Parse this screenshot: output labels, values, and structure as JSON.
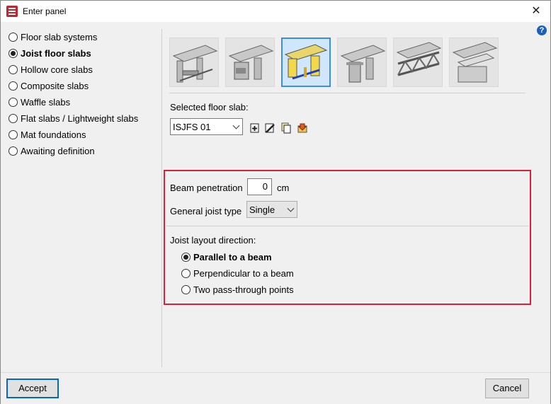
{
  "window": {
    "title": "Enter panel",
    "close_glyph": "✕"
  },
  "help": {
    "glyph": "?"
  },
  "slab_types": [
    {
      "label": "Floor slab systems",
      "checked": false
    },
    {
      "label": "Joist floor slabs",
      "checked": true
    },
    {
      "label": "Hollow core slabs",
      "checked": false
    },
    {
      "label": "Composite slabs",
      "checked": false
    },
    {
      "label": "Waffle slabs",
      "checked": false
    },
    {
      "label": "Flat slabs / Lightweight slabs",
      "checked": false
    },
    {
      "label": "Mat foundations",
      "checked": false
    },
    {
      "label": "Awaiting definition",
      "checked": false
    }
  ],
  "thumbnails": [
    {
      "icon": "joist-type-1-icon",
      "selected": false
    },
    {
      "icon": "joist-type-2-icon",
      "selected": false
    },
    {
      "icon": "joist-type-3-icon",
      "selected": true
    },
    {
      "icon": "joist-type-4-icon",
      "selected": false
    },
    {
      "icon": "truss-joist-icon",
      "selected": false
    },
    {
      "icon": "solid-block-icon",
      "selected": false
    }
  ],
  "selected_floor_slab": {
    "label": "Selected floor slab:",
    "value": "ISJFS 01"
  },
  "tools": [
    "add-icon",
    "edit-icon",
    "copy-icon",
    "import-icon"
  ],
  "beam_penetration": {
    "label": "Beam penetration",
    "value": "0",
    "unit": "cm"
  },
  "general_joist_type": {
    "label": "General joist type",
    "value": "Single"
  },
  "joist_layout": {
    "label": "Joist layout direction:",
    "options": [
      {
        "label": "Parallel to a beam",
        "checked": true
      },
      {
        "label": "Perpendicular to a beam",
        "checked": false
      },
      {
        "label": "Two pass-through points",
        "checked": false
      }
    ]
  },
  "buttons": {
    "accept": "Accept",
    "cancel": "Cancel"
  },
  "colors": {
    "highlight": "#d8203a",
    "selection": "#3b8ee8",
    "default_button": "#0a64c8"
  }
}
